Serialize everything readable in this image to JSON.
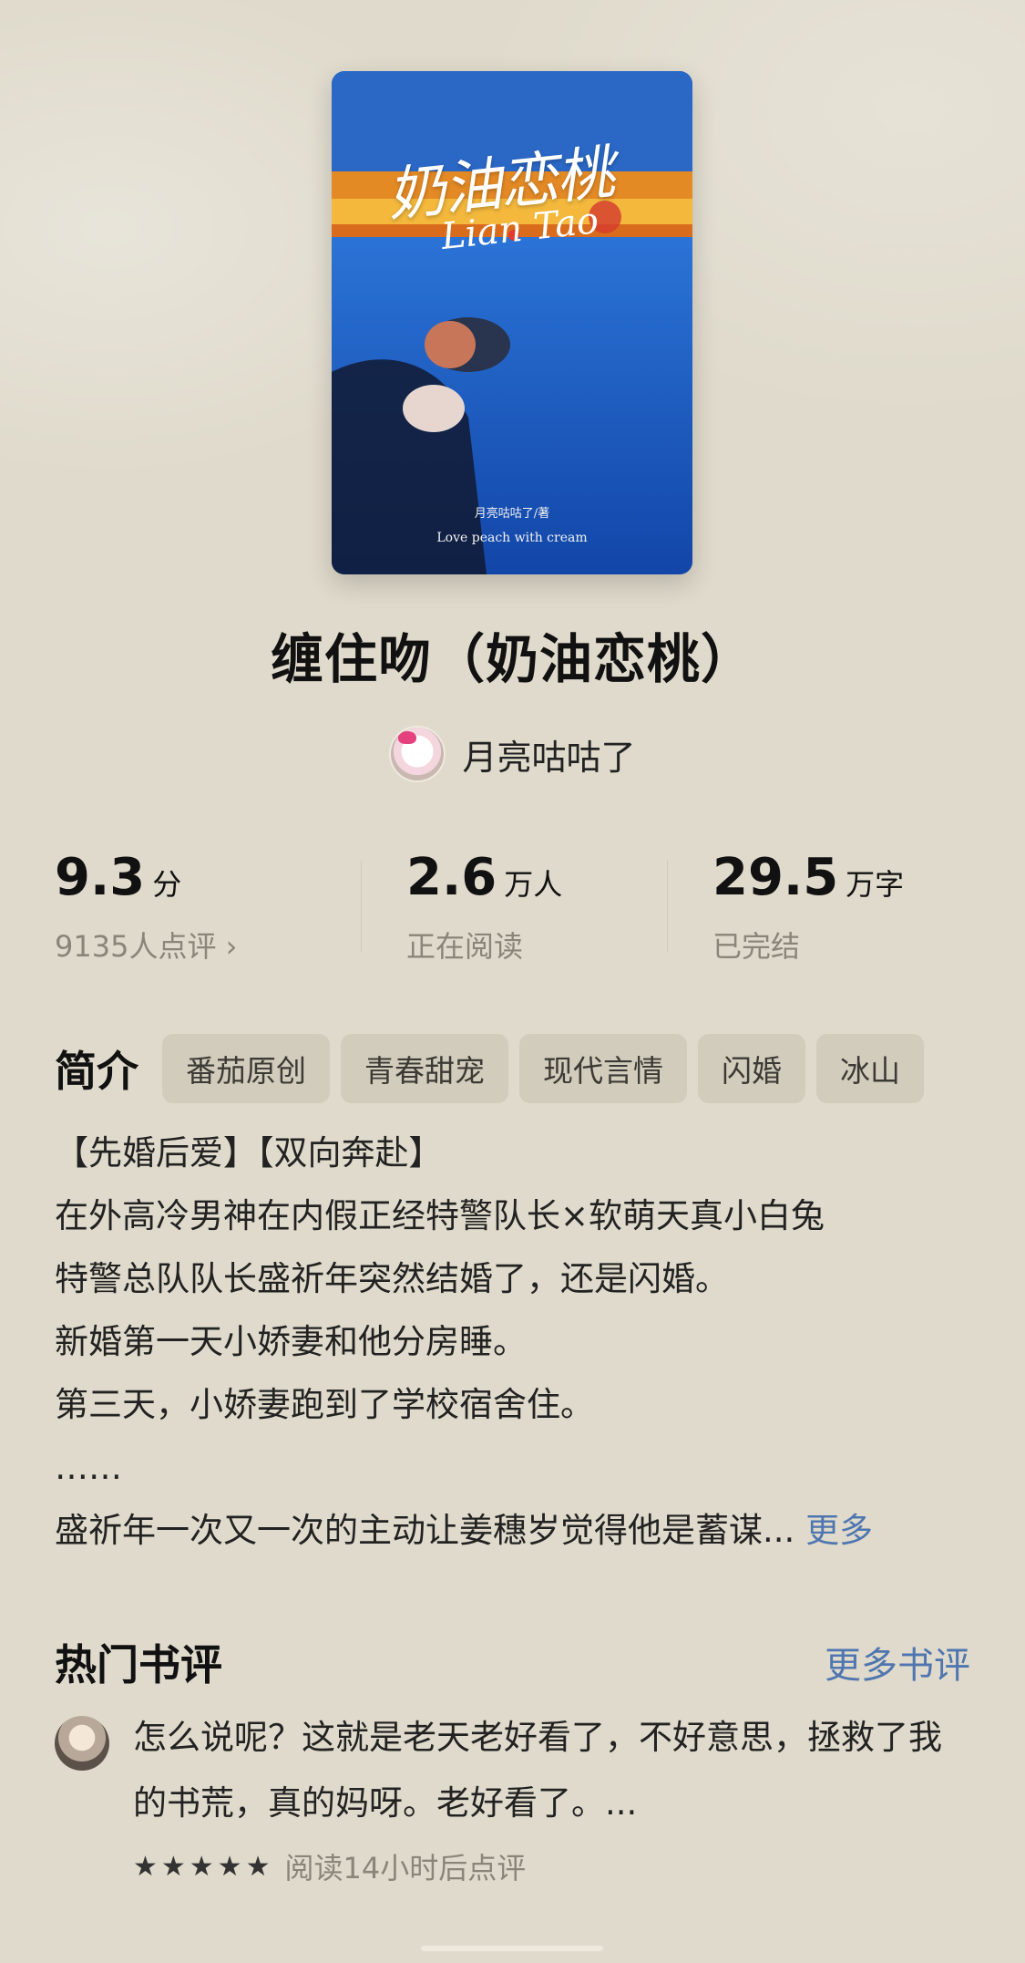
{
  "book": {
    "cover": {
      "title_art": "奶油恋桃",
      "title_latin": "Lian Tao",
      "author_line": "月亮咕咕了/著",
      "english": "Love peach with cream"
    },
    "title": "缠住吻（奶油恋桃）",
    "author": "月亮咕咕了"
  },
  "stats": [
    {
      "value": "9.3",
      "unit": "分",
      "sub": "9135人点评 ›"
    },
    {
      "value": "2.6",
      "unit": "万人",
      "sub": "正在阅读"
    },
    {
      "value": "29.5",
      "unit": "万字",
      "sub": "已完结"
    }
  ],
  "intro": {
    "label": "简介",
    "tags": [
      "番茄原创",
      "青春甜宠",
      "现代言情",
      "闪婚",
      "冰山"
    ],
    "lines": [
      "【先婚后爱】【双向奔赴】",
      "在外高冷男神在内假正经特警队长×软萌天真小白兔",
      "特警总队队长盛祈年突然结婚了，还是闪婚。",
      "新婚第一天小娇妻和他分房睡。",
      "第三天，小娇妻跑到了学校宿舍住。",
      "……",
      "盛祈年一次又一次的主动让姜穗岁觉得他是蓄谋..."
    ],
    "more": "更多"
  },
  "reviews": {
    "title": "热门书评",
    "more": "更多书评",
    "items": [
      {
        "text": "怎么说呢？这就是老天老好看了，不好意思，拯救了我的书荒，真的妈呀。老好看了。...",
        "stars": "★★★★★",
        "rating": 5,
        "meta": "阅读14小时后点评"
      }
    ]
  },
  "colors": {
    "background": "#dfdacb",
    "accent": "#4f76b0",
    "muted": "#8a8578",
    "tag_bg": "#d2ccbc"
  }
}
